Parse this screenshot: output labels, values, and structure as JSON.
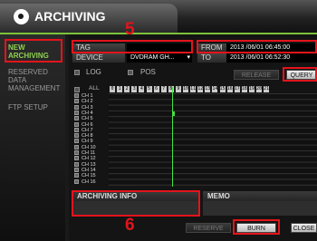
{
  "app": {
    "title": "ARCHIVING"
  },
  "sidebar": {
    "items": [
      {
        "label_lines": [
          "NEW",
          "ARCHIVING"
        ]
      },
      {
        "label_lines": [
          "RESERVED",
          "DATA",
          "MANAGEMENT"
        ]
      },
      {
        "label_lines": [
          "FTP SETUP"
        ]
      }
    ]
  },
  "form": {
    "tag_label": "TAG",
    "tag_value": "",
    "device_label": "DEVICE",
    "device_value": "DVDRAM GH...",
    "from_label": "FROM",
    "from_value": "2013 /06/01  06:45:00",
    "to_label": "TO",
    "to_value": "2013 /06/01  06:52:30"
  },
  "options": {
    "log_label": "LOG",
    "pos_label": "POS",
    "release_label": "RELEASE",
    "query_label": "QUERY"
  },
  "timeline": {
    "all_label": "ALL",
    "hours": [
      "0",
      "1",
      "2",
      "3",
      "4",
      "5",
      "6",
      "7",
      "8",
      "9",
      "10",
      "11",
      "12",
      "13",
      "14",
      "15",
      "16",
      "17",
      "18",
      "19",
      "20",
      "21"
    ],
    "channels": [
      "CH 1",
      "CH 2",
      "CH 3",
      "CH 4",
      "CH 5",
      "CH 6",
      "CH 7",
      "CH 8",
      "CH 9",
      "CH 10",
      "CH 11",
      "CH 12",
      "CH 13",
      "CH 14",
      "CH 15",
      "CH 16"
    ]
  },
  "info": {
    "archiving_info_label": "ARCHIVING INFO",
    "memo_label": "MEMO"
  },
  "buttons": {
    "reserve": "RESERVE",
    "burn": "BURN",
    "close": "CLOSE"
  },
  "annotations": {
    "num5": "5",
    "num6": "6",
    "accent": "#7cc23a",
    "marker": "#e3141b"
  }
}
